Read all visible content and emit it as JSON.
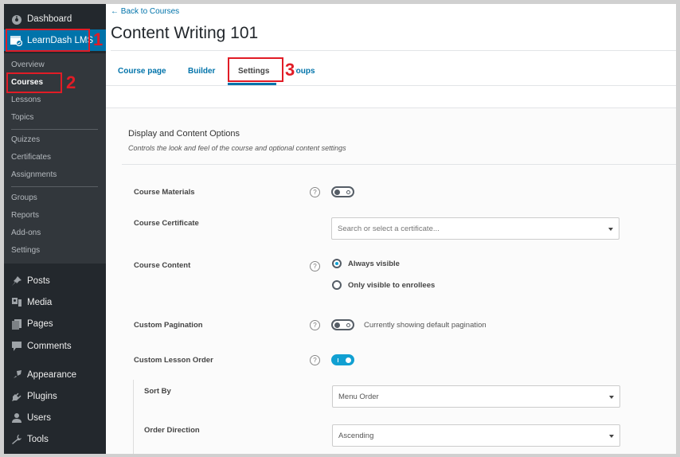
{
  "sidebar": {
    "top": [
      {
        "label": "Dashboard",
        "icon": "dashboard-icon"
      },
      {
        "label": "LearnDash LMS",
        "icon": "learndash-icon",
        "active": true
      }
    ],
    "submenu": [
      {
        "label": "Overview"
      },
      {
        "label": "Courses",
        "current": true
      },
      {
        "label": "Lessons"
      },
      {
        "label": "Topics"
      },
      {
        "label": "Quizzes"
      },
      {
        "label": "Certificates"
      },
      {
        "label": "Assignments"
      },
      {
        "label": "Groups"
      },
      {
        "label": "Reports"
      },
      {
        "label": "Add-ons"
      },
      {
        "label": "Settings"
      }
    ],
    "bottom": [
      {
        "label": "Posts",
        "icon": "pin-icon"
      },
      {
        "label": "Media",
        "icon": "media-icon"
      },
      {
        "label": "Pages",
        "icon": "pages-icon"
      },
      {
        "label": "Comments",
        "icon": "comment-icon"
      },
      {
        "label": "Appearance",
        "icon": "paintbrush-icon"
      },
      {
        "label": "Plugins",
        "icon": "plugin-icon"
      },
      {
        "label": "Users",
        "icon": "user-icon"
      },
      {
        "label": "Tools",
        "icon": "wrench-icon"
      }
    ]
  },
  "annotations": {
    "n1": "1",
    "n2": "2",
    "n3": "3",
    "color": "#e11c26"
  },
  "header": {
    "back_link": "← Back to Courses",
    "title": "Content Writing 101",
    "tabs": [
      {
        "label": "Course page"
      },
      {
        "label": "Builder"
      },
      {
        "label": "Settings",
        "active": true
      },
      {
        "label": "Groups"
      }
    ]
  },
  "section": {
    "title": "Display and Content Options",
    "description": "Controls the look and feel of the course and optional content settings",
    "help_glyph": "?",
    "fields": {
      "course_materials": {
        "label": "Course Materials",
        "enabled": false
      },
      "course_certificate": {
        "label": "Course Certificate",
        "placeholder": "Search or select a certificate..."
      },
      "course_content": {
        "label": "Course Content",
        "options": [
          {
            "label": "Always visible",
            "checked": true
          },
          {
            "label": "Only visible to enrollees",
            "checked": false
          }
        ]
      },
      "custom_pagination": {
        "label": "Custom Pagination",
        "enabled": false,
        "note": "Currently showing default pagination"
      },
      "custom_lesson_order": {
        "label": "Custom Lesson Order",
        "enabled": true
      },
      "sort_by": {
        "label": "Sort By",
        "value": "Menu Order"
      },
      "order_direction": {
        "label": "Order Direction",
        "value": "Ascending"
      }
    }
  },
  "colors": {
    "accent": "#0073aa",
    "toggle_on": "#11a0d2",
    "sidebar_bg": "#23282d",
    "submenu_bg": "#32373c"
  }
}
